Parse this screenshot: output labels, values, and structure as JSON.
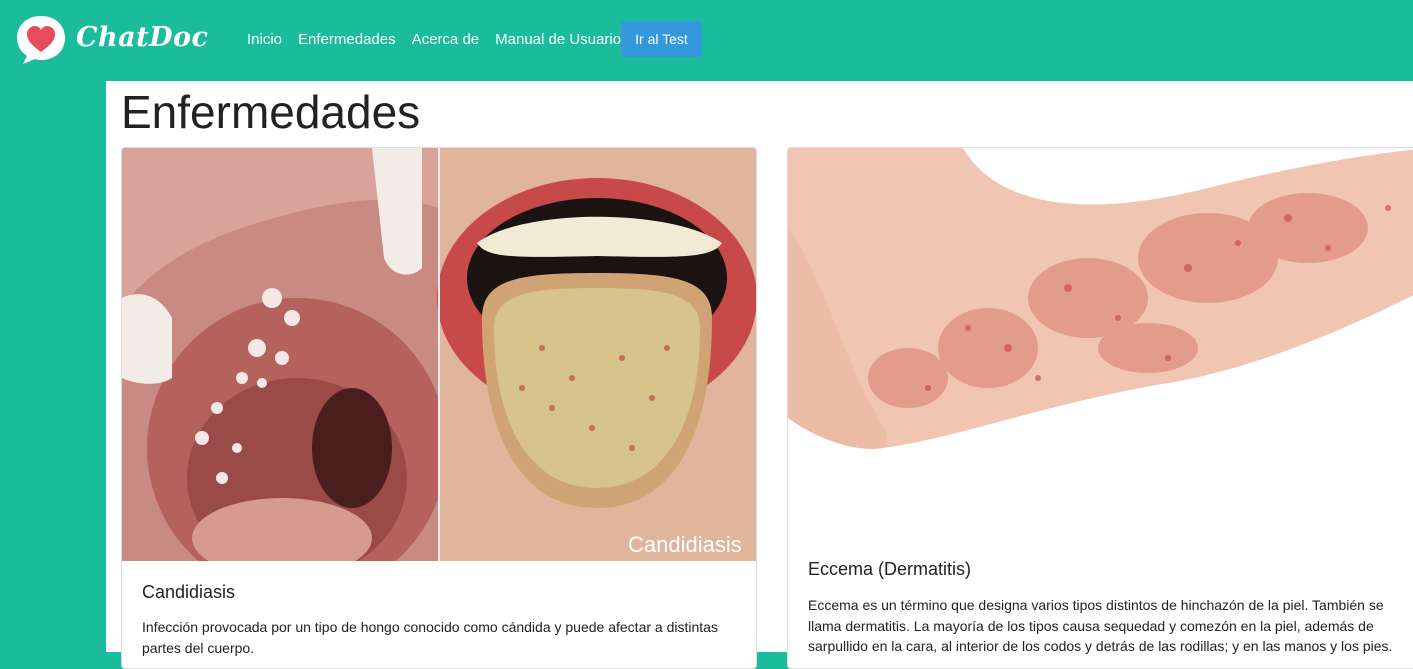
{
  "brand": {
    "name": "ChatDoc",
    "logo_icon": "heart-chat-bubble-icon"
  },
  "nav": {
    "links": [
      "Inicio",
      "Enfermedades",
      "Acerca de",
      "Manual de Usuario"
    ],
    "cta": "Ir al Test"
  },
  "page": {
    "title": "Enfermedades"
  },
  "cards": [
    {
      "image_caption": "Candidiasis",
      "title": "Candidiasis",
      "text": "Infección provocada por un tipo de hongo conocido como cándida y puede afectar a distintas partes del cuerpo."
    },
    {
      "title": "Eccema (Dermatitis)",
      "text": "Eccema es un término que designa varios tipos distintos de hinchazón de la piel. También se llama dermatitis. La mayoría de los tipos causa sequedad y comezón en la piel, además de sarpullido en la cara, al interior de los codos y detrás de las rodillas; y en las manos y los pies."
    }
  ],
  "colors": {
    "navbar": "#1abc9c",
    "cta": "#3498db",
    "logo_heart": "#e74c5c"
  }
}
